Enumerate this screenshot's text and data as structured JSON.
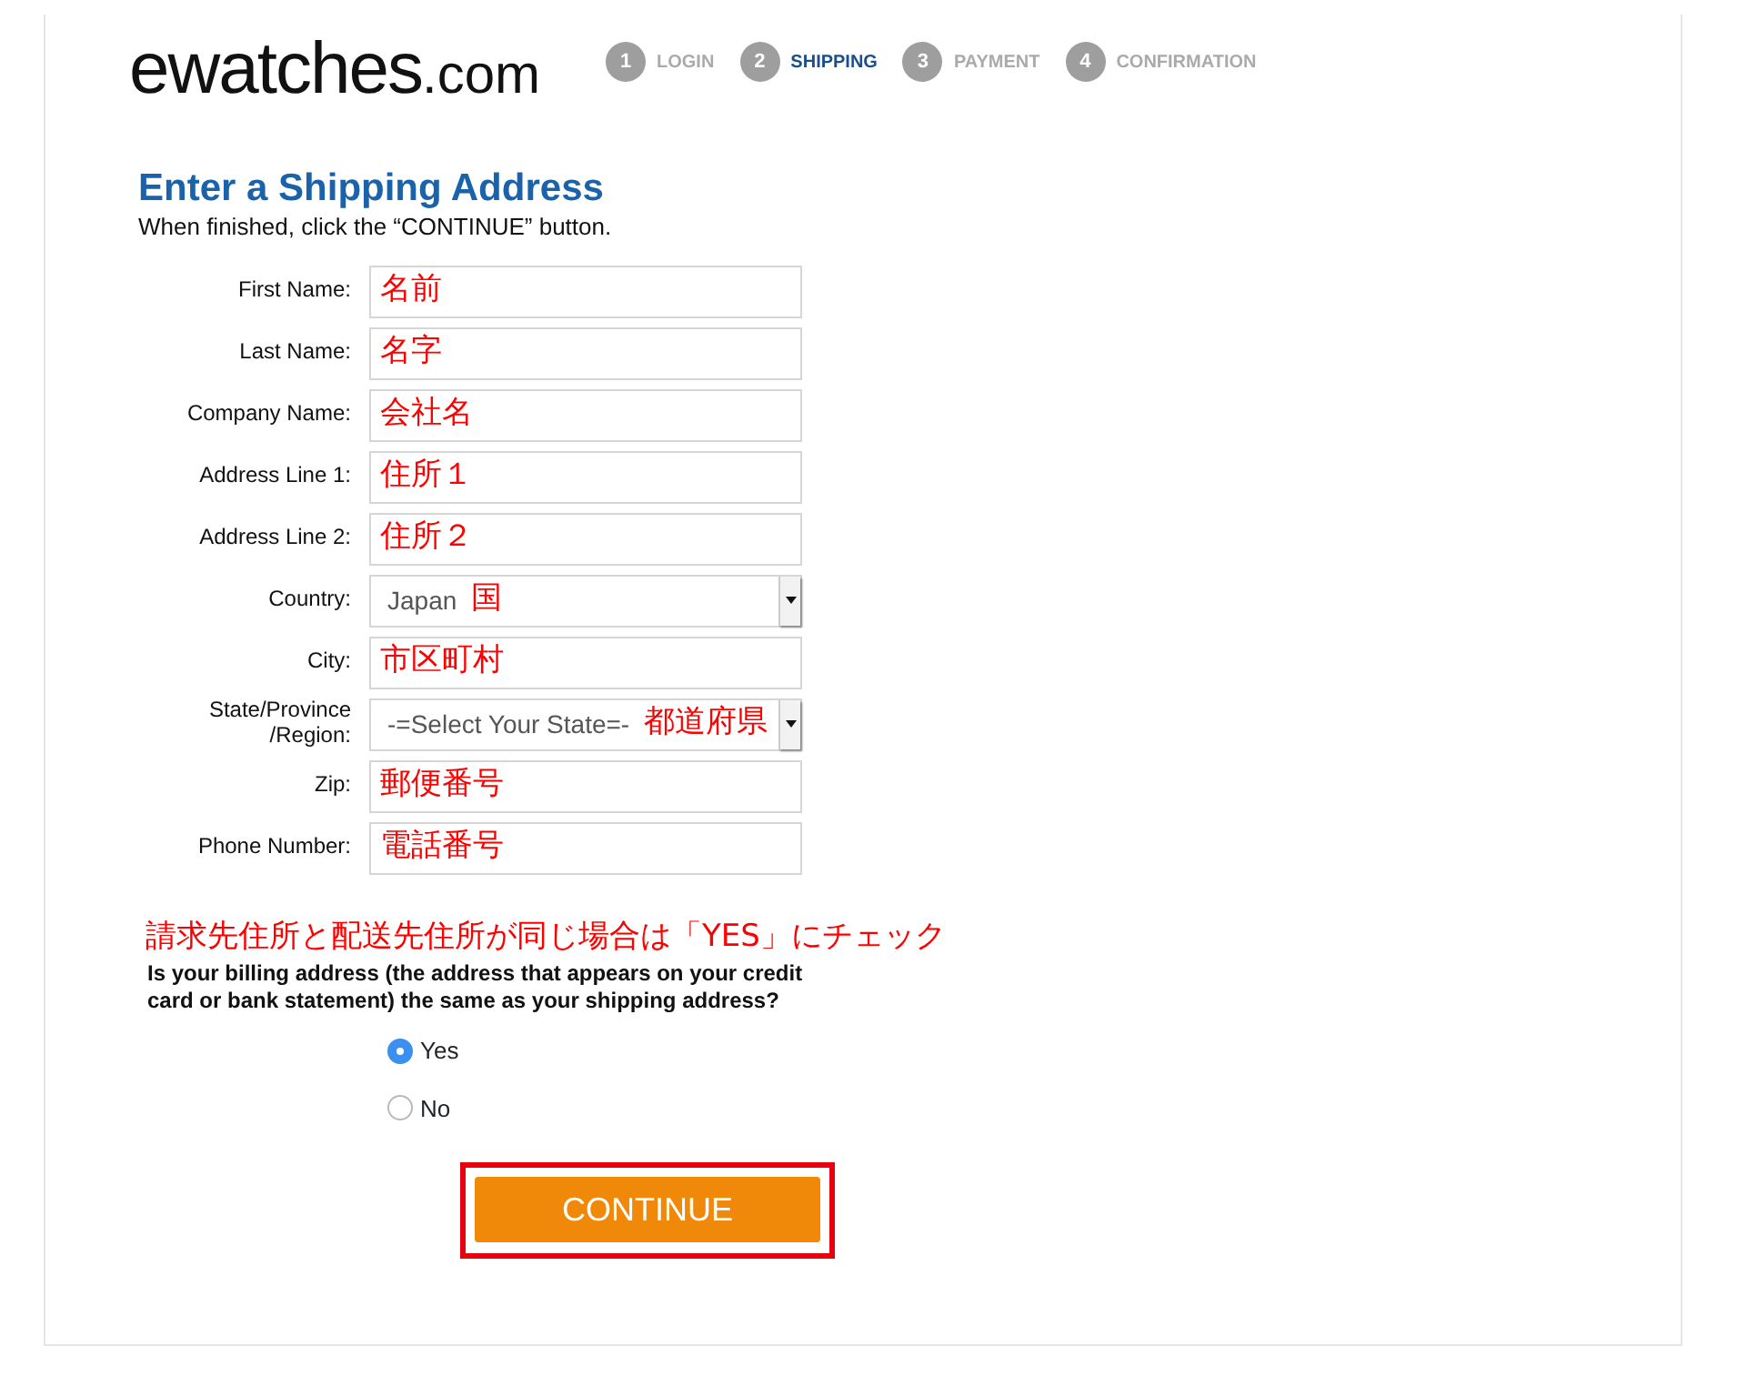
{
  "logo": {
    "name": "ewatches",
    "suffix": ".com"
  },
  "steps": [
    {
      "number": "1",
      "label": "LOGIN",
      "selected": false
    },
    {
      "number": "2",
      "label": "SHIPPING",
      "selected": true
    },
    {
      "number": "3",
      "label": "PAYMENT",
      "selected": false
    },
    {
      "number": "4",
      "label": "CONFIRMATION",
      "selected": false
    }
  ],
  "heading": "Enter a Shipping Address",
  "instruction": "When finished, click the “CONTINUE” button.",
  "fields": [
    {
      "label": "First Name:",
      "kind": "text",
      "annotation": "名前"
    },
    {
      "label": "Last Name:",
      "kind": "text",
      "annotation": "名字"
    },
    {
      "label": "Company Name:",
      "kind": "text",
      "annotation": "会社名"
    },
    {
      "label": "Address Line 1:",
      "kind": "text",
      "annotation": "住所１"
    },
    {
      "label": "Address Line 2:",
      "kind": "text",
      "annotation": "住所２"
    },
    {
      "label": "Country:",
      "kind": "select",
      "value": "Japan",
      "annotation": "国"
    },
    {
      "label": "City:",
      "kind": "text",
      "annotation": "市区町村"
    },
    {
      "label": "State/Province /Region:",
      "kind": "select",
      "value": "-=Select Your State=-",
      "annotation": "都道府県"
    },
    {
      "label": "Zip:",
      "kind": "text",
      "annotation": "郵便番号"
    },
    {
      "label": "Phone Number:",
      "kind": "text",
      "annotation": "電話番号"
    }
  ],
  "billing_note": "請求先住所と配送先住所が同じ場合は「YES」にチェック",
  "billing_question": "Is your billing address (the address that appears on your credit card or bank statement) the same as your shipping address?",
  "billing_options": [
    {
      "label": "Yes",
      "selected": true
    },
    {
      "label": "No",
      "selected": false
    }
  ],
  "continue_button": "CONTINUE"
}
